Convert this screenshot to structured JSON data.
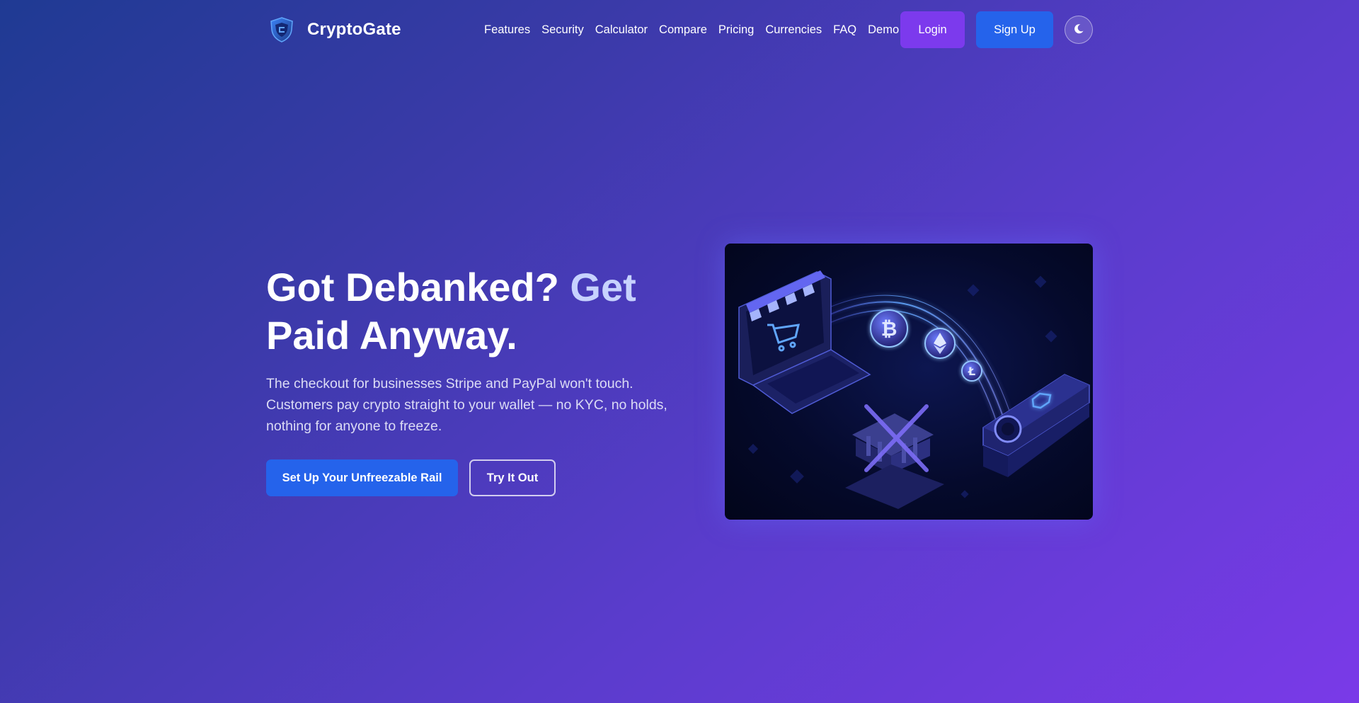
{
  "brand": {
    "name": "CryptoGate",
    "logo_icon": "shield-icon"
  },
  "nav": {
    "items": [
      {
        "label": "Features"
      },
      {
        "label": "Security"
      },
      {
        "label": "Calculator"
      },
      {
        "label": "Compare"
      },
      {
        "label": "Pricing"
      },
      {
        "label": "Currencies"
      },
      {
        "label": "FAQ"
      },
      {
        "label": "Demo"
      }
    ],
    "login_label": "Login",
    "signup_label": "Sign Up",
    "theme_toggle_icon": "moon-icon"
  },
  "hero": {
    "title_part1": "Got Debanked? ",
    "title_part2": "Get",
    "title_part3": "Paid Anyway.",
    "subtitle": "The checkout for businesses Stripe and PayPal won't touch. Customers pay crypto straight to your wallet — no KYC, no holds, nothing for anyone to freeze.",
    "cta_primary": "Set Up Your Unfreezable Rail",
    "cta_secondary": "Try It Out",
    "illustration_icons": [
      "shopping-cart-icon",
      "bitcoin-icon",
      "ethereum-icon",
      "litecoin-icon",
      "bank-icon",
      "hardware-wallet-icon"
    ]
  },
  "colors": {
    "login_bg": "#7c3aed",
    "signup_bg": "#2563eb",
    "cta_primary_bg": "#2563eb",
    "title_accent": "#c7d2fe"
  }
}
